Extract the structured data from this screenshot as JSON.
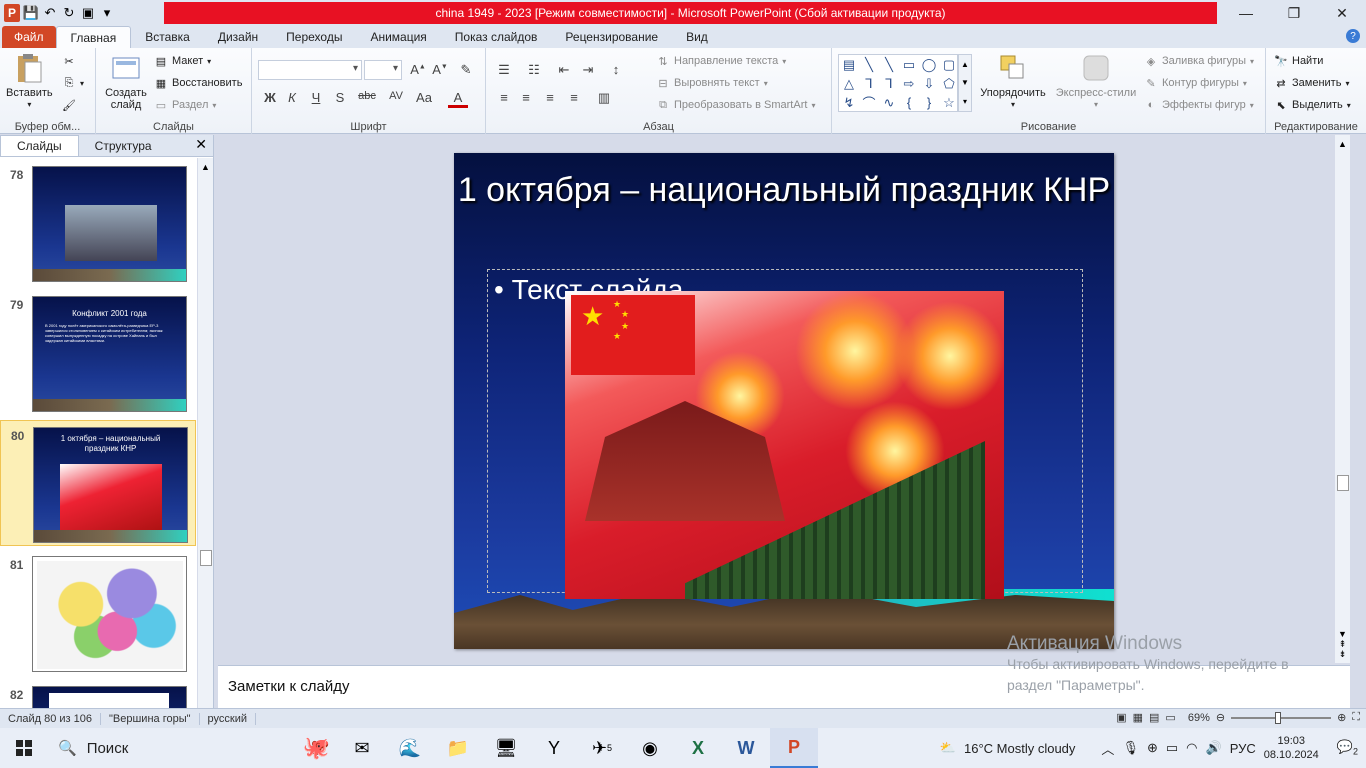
{
  "window": {
    "title": "china 1949 - 2023 [Режим совместимости] - Microsoft PowerPoint (Сбой активации продукта)",
    "app_icon_letter": "P"
  },
  "ribbon_tabs": [
    {
      "label": "Файл"
    },
    {
      "label": "Главная"
    },
    {
      "label": "Вставка"
    },
    {
      "label": "Дизайн"
    },
    {
      "label": "Переходы"
    },
    {
      "label": "Анимация"
    },
    {
      "label": "Показ слайдов"
    },
    {
      "label": "Рецензирование"
    },
    {
      "label": "Вид"
    }
  ],
  "clipboard": {
    "paste": "Вставить",
    "group": "Буфер обм..."
  },
  "slides_group": {
    "create": "Создать слайд",
    "layout": "Макет",
    "reset": "Восстановить",
    "section": "Раздел",
    "group": "Слайды"
  },
  "font_group": {
    "group": "Шрифт",
    "bold": "Ж",
    "italic": "К",
    "underline": "Ч",
    "shadow": "S",
    "strike": "abc",
    "spacing": "AV",
    "case": "Aa",
    "color": "A"
  },
  "paragraph_group": {
    "text_direction": "Направление текста",
    "align_text": "Выровнять текст",
    "smartart": "Преобразовать в SmartArt",
    "group": "Абзац"
  },
  "drawing_group": {
    "arrange": "Упорядочить",
    "quick_styles": "Экспресс-стили",
    "fill": "Заливка фигуры",
    "outline": "Контур фигуры",
    "effects": "Эффекты фигур",
    "group": "Рисование"
  },
  "editing_group": {
    "find": "Найти",
    "replace": "Заменить",
    "select": "Выделить",
    "group": "Редактирование"
  },
  "left_panel": {
    "tab_slides": "Слайды",
    "tab_outline": "Структура",
    "thumbnails": [
      {
        "number": "78",
        "title": "",
        "body": ""
      },
      {
        "number": "79",
        "title": "Конфликт  2001 года",
        "body": "В 2001 году полёт американского самолёта-разведчика EP-3 завершился столкновением с китайским истребителем; экипаж совершил вынужденную посадку на острове Хайнань и был задержан китайскими властями."
      },
      {
        "number": "80",
        "title": "1 октября – национальный праздник КНР",
        "body": ""
      },
      {
        "number": "81",
        "title": "",
        "body": ""
      },
      {
        "number": "82",
        "title": "",
        "body": ""
      }
    ]
  },
  "slide": {
    "title": "1 октября – национальный праздник КНР",
    "bullet": "Текст слайда"
  },
  "notes": {
    "placeholder": "Заметки к слайду"
  },
  "activation": {
    "line1": "Активация Windows",
    "line2": "Чтобы активировать Windows, перейдите в",
    "line3": "раздел \"Параметры\"."
  },
  "status": {
    "slide_counter": "Слайд 80 из 106",
    "theme": "\"Вершина горы\"",
    "language": "русский",
    "zoom": "69%"
  },
  "taskbar": {
    "search": "Поиск",
    "weather": "16°C  Mostly cloudy",
    "lang": "РУС",
    "time": "19:03",
    "date": "08.10.2024",
    "notif_count": "2",
    "badge_count": "5"
  }
}
